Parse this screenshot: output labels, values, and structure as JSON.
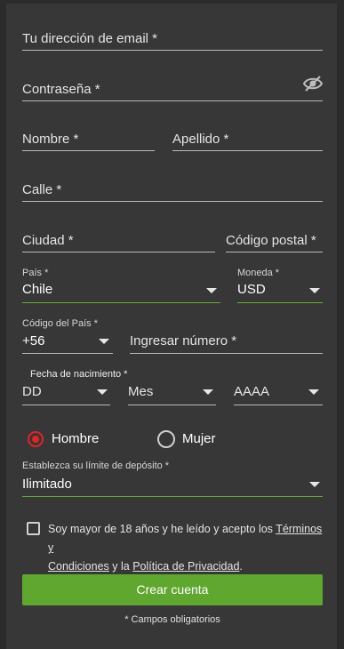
{
  "form": {
    "email_label": "Tu dirección de email *",
    "password_label": "Contraseña *",
    "first_name_label": "Nombre *",
    "last_name_label": "Apellido *",
    "street_label": "Calle *",
    "city_label": "Ciudad *",
    "postal_label": "Código postal *",
    "country_label": "País *",
    "country_value": "Chile",
    "currency_label": "Moneda *",
    "currency_value": "USD",
    "country_code_label": "Código del País *",
    "country_code_value": "+56",
    "phone_placeholder": "Ingresar número *",
    "dob_label": "Fecha de nacimiento *",
    "dob_day": "DD",
    "dob_month": "Mes",
    "dob_year": "AAAA",
    "gender_male": "Hombre",
    "gender_female": "Mujer",
    "gender_selected": "Hombre",
    "deposit_label": "Establezca su límite de depósito *",
    "deposit_value": "Ilimitado",
    "terms_text_1": "Soy mayor de 18 años y he leído y acepto los ",
    "terms_link_1a": "Términos y",
    "terms_link_1b": "Condiciones",
    "terms_text_2": " y la ",
    "terms_link_2": "Política de Privacidad",
    "terms_text_3": ".",
    "submit_label": "Crear cuenta",
    "required_note": "* Campos obligatorios"
  },
  "icons": {
    "password_toggle": "eye-slash-icon",
    "dropdown": "chevron-down-icon"
  },
  "colors": {
    "background": "#373737",
    "accent_green": "#5fa72f",
    "radio_selected": "#e02424"
  }
}
